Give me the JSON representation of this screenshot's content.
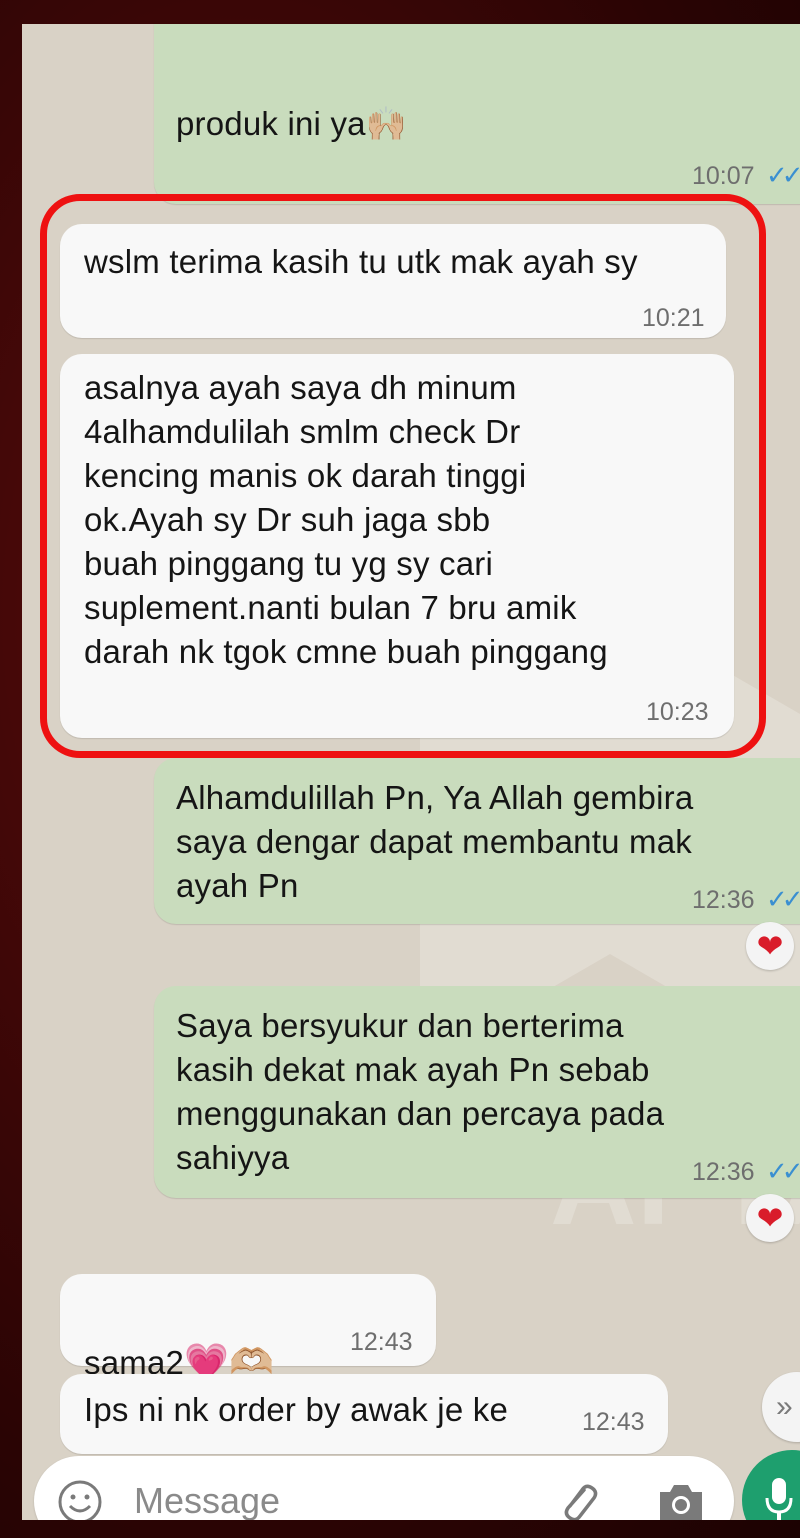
{
  "messages": [
    {
      "text": "produk ini ya",
      "emoji": "🙌🏼",
      "time": "10:07",
      "ticks": "✓✓"
    },
    {
      "text": "wslm terima kasih tu utk mak ayah sy",
      "time": "10:21"
    },
    {
      "text": "asalnya ayah saya dh minum\n4alhamdulilah smlm check Dr\nkencing manis ok darah tinggi\nok.Ayah sy Dr suh jaga sbb\nbuah pinggang tu yg sy cari\nsuplement.nanti bulan 7 bru amik\ndarah nk tgok cmne buah pinggang",
      "time": "10:23"
    },
    {
      "text": "Alhamdulillah Pn, Ya Allah gembira\nsaya dengar dapat membantu mak\nayah Pn",
      "time": "12:36",
      "ticks": "✓✓",
      "reaction": "❤"
    },
    {
      "text": "Saya bersyukur dan berterima\nkasih dekat mak ayah Pn sebab\nmenggunakan dan percaya pada\nsahiyya",
      "time": "12:36",
      "ticks": "✓✓",
      "reaction": "❤"
    },
    {
      "text": "sama2",
      "emoji": "💗🫶🏼",
      "time": "12:43"
    },
    {
      "text": "Ips ni nk order by awak je ke",
      "time": "12:43"
    }
  ],
  "input": {
    "placeholder": "Message"
  },
  "watermark": "AFYAA",
  "colors": {
    "outgoing": "#c9dcbd",
    "incoming": "#f8f8f8",
    "highlight": "#ee1111",
    "accent": "#1e9f6e"
  }
}
